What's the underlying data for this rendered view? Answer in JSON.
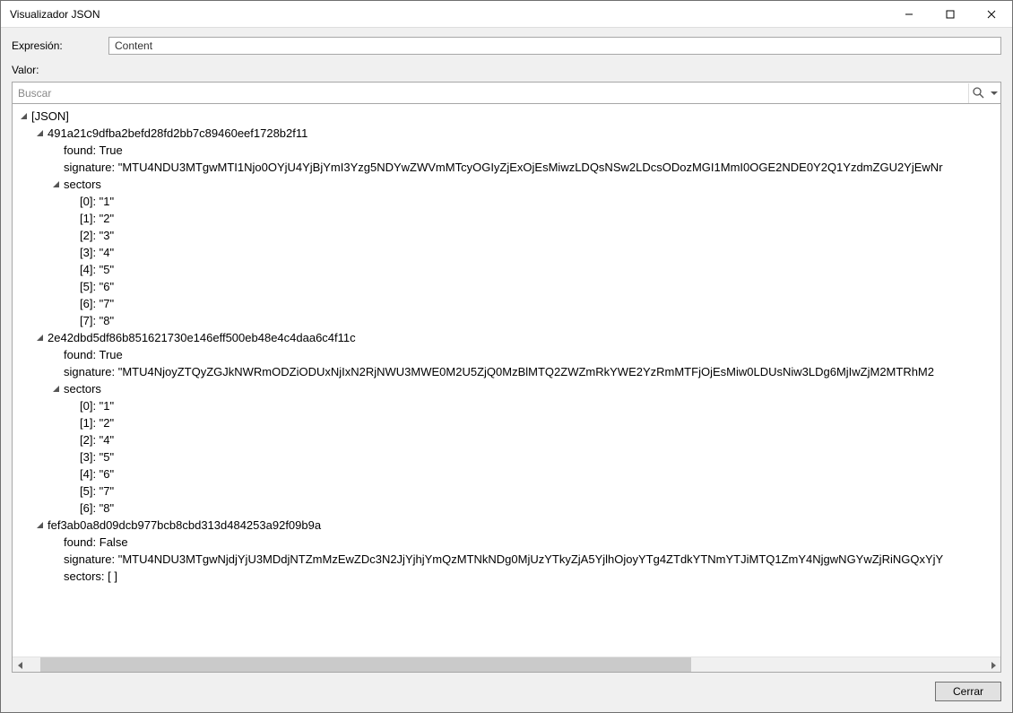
{
  "window": {
    "title": "Visualizador JSON",
    "minimize_glyph": "—",
    "maximize_glyph": "☐",
    "close_glyph": "✕"
  },
  "labels": {
    "expresion": "Expresión:",
    "valor": "Valor:",
    "search_placeholder": "Buscar",
    "cerrar": "Cerrar"
  },
  "expression": {
    "value": "Content"
  },
  "tree": {
    "root_label": "[JSON]",
    "nodes": [
      {
        "key": "491a21c9dfba2befd28fd2bb7c89460eef1728b2f11",
        "found_label": "found: True",
        "signature_label": "signature: \"MTU4NDU3MTgwMTI1Njo0OYjU4YjBjYmI3Yzg5NDYwZWVmMTcyOGIyZjExOjEsMiwzLDQsNSw2LDcsODozMGI1MmI0OGE2NDE0Y2Q1YzdmZGU2YjEwNr",
        "sectors_label": "sectors",
        "sectors": [
          {
            "idx": "[0]:",
            "val": "\"1\""
          },
          {
            "idx": "[1]:",
            "val": "\"2\""
          },
          {
            "idx": "[2]:",
            "val": "\"3\""
          },
          {
            "idx": "[3]:",
            "val": "\"4\""
          },
          {
            "idx": "[4]:",
            "val": "\"5\""
          },
          {
            "idx": "[5]:",
            "val": "\"6\""
          },
          {
            "idx": "[6]:",
            "val": "\"7\""
          },
          {
            "idx": "[7]:",
            "val": "\"8\""
          }
        ]
      },
      {
        "key": "2e42dbd5df86b851621730e146eff500eb48e4c4daa6c4f11c",
        "found_label": "found: True",
        "signature_label": "signature: \"MTU4NjoyZTQyZGJkNWRmODZiODUxNjIxN2RjNWU3MWE0M2U5ZjQ0MzBlMTQ2ZWZmRkYWE2YzRmMTFjOjEsMiw0LDUsNiw3LDg6MjIwZjM2MTRhM2",
        "sectors_label": "sectors",
        "sectors": [
          {
            "idx": "[0]:",
            "val": "\"1\""
          },
          {
            "idx": "[1]:",
            "val": "\"2\""
          },
          {
            "idx": "[2]:",
            "val": "\"4\""
          },
          {
            "idx": "[3]:",
            "val": "\"5\""
          },
          {
            "idx": "[4]:",
            "val": "\"6\""
          },
          {
            "idx": "[5]:",
            "val": "\"7\""
          },
          {
            "idx": "[6]:",
            "val": "\"8\""
          }
        ]
      },
      {
        "key": "fef3ab0a8d09dcb977bcb8cbd313d484253a92f09b9a",
        "found_label": "found: False",
        "signature_label": "signature: \"MTU4NDU3MTgwNjdjYjU3MDdjNTZmMzEwZDc3N2JjYjhjYmQzMTNkNDg0MjUzYTkyZjA5YjlhOjoyYTg4ZTdkYTNmYTJiMTQ1ZmY4NjgwNGYwZjRiNGQxYjY",
        "sectors_empty_label": "sectors: [ ]"
      }
    ]
  }
}
